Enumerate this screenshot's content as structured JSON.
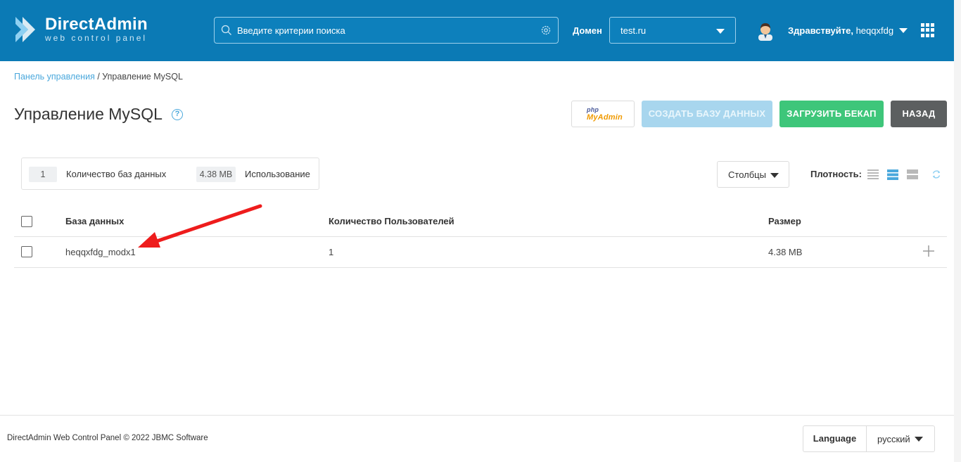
{
  "header": {
    "logo_title": "DirectAdmin",
    "logo_subtitle": "web control panel",
    "search_placeholder": "Введите критерии поиска",
    "domain_label": "Домен",
    "domain_value": "test.ru",
    "greeting_prefix": "Здравствуйте,",
    "username": "heqqxfdg"
  },
  "breadcrumb": {
    "root": "Панель управления",
    "separator": " / ",
    "current": "Управление MySQL"
  },
  "page": {
    "title": "Управление MySQL",
    "help": "?"
  },
  "actions": {
    "phpmyadmin_php": "php",
    "phpmyadmin_name": "MyAdmin",
    "create_db": "СОЗДАТЬ БАЗУ ДАННЫХ",
    "upload_backup": "ЗАГРУЗИТЬ БЕКАП",
    "back": "НАЗАД"
  },
  "stats": {
    "db_count": "1",
    "db_count_label": "Количество баз данных",
    "usage": "4.38 MB",
    "usage_label": "Использование"
  },
  "toolbar": {
    "columns": "Столбцы",
    "density_label": "Плотность:"
  },
  "table": {
    "columns": [
      "База данных",
      "Количество Пользователей",
      "Размер"
    ],
    "rows": [
      {
        "database": "heqqxfdg_modx1",
        "users": "1",
        "size": "4.38 MB"
      }
    ]
  },
  "footer": {
    "copyright": "DirectAdmin Web Control Panel © 2022 JBMC Software",
    "language_label": "Language",
    "language_value": "русский"
  },
  "colors": {
    "header_bg": "#0b7ab5",
    "link": "#4aa8dc",
    "create_button": "#a8d6ee",
    "upload_button": "#3ec67a",
    "back_button": "#5c5f60",
    "annotation_arrow": "#ee1c1c"
  }
}
